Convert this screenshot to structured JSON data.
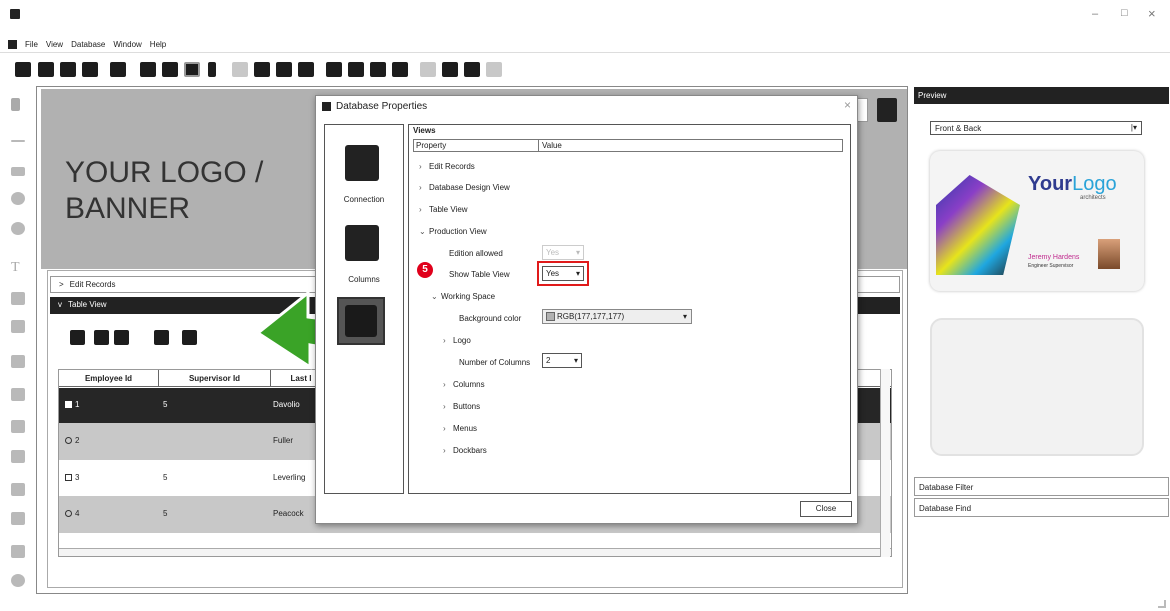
{
  "menu": {
    "items": [
      "File",
      "View",
      "Database",
      "Window",
      "Help"
    ]
  },
  "window_controls": {
    "minimize": "–",
    "maximize": "□",
    "close": "×"
  },
  "canvas": {
    "logo_line1": "YOUR LOGO /",
    "logo_line2": "BANNER"
  },
  "records": {
    "edit_records": "Edit Records",
    "table_view": "Table View",
    "columns": [
      "Employee Id",
      "Supervisor Id",
      "Last I"
    ],
    "rows": [
      {
        "id": "1",
        "sup": "5",
        "last": "Davolio"
      },
      {
        "id": "2",
        "sup": "",
        "last": "Fuller"
      },
      {
        "id": "3",
        "sup": "5",
        "last": "Leverling"
      },
      {
        "id": "4",
        "sup": "5",
        "last": "Peacock"
      }
    ]
  },
  "dialog": {
    "title": "Database Properties",
    "close_x": "×",
    "nav": [
      {
        "label": "Connection"
      },
      {
        "label": "Columns"
      }
    ],
    "group": "Views",
    "header_property": "Property",
    "header_value": "Value",
    "props": {
      "edit_records": "Edit Records",
      "db_design": "Database Design View",
      "table_view": "Table View",
      "production_view": "Production View",
      "edition_allowed": "Edition allowed",
      "edition_allowed_value": "Yes",
      "show_table_view": "Show Table View",
      "show_table_view_value": "Yes",
      "working_space": "Working Space",
      "background_color": "Background color",
      "background_color_value": "RGB(177,177,177)",
      "logo": "Logo",
      "number_of_columns": "Number of Columns",
      "number_of_columns_value": "2",
      "columns": "Columns",
      "buttons": "Buttons",
      "menus": "Menus",
      "dockbars": "Dockbars"
    },
    "close_button": "Close",
    "step_badge": "5"
  },
  "preview": {
    "title": "Preview",
    "select_value": "Front & Back",
    "card": {
      "logo_your": "Your",
      "logo_logo": "Logo",
      "logo_sub": "architects",
      "name": "Jeremy Hardens",
      "role": "Engineer Supervisor"
    }
  },
  "panels": {
    "filter": "Database Filter",
    "find": "Database Find"
  },
  "colors": {
    "dark": "#222222",
    "canvas_gray": "#b1b1b1",
    "badge_red": "#e0001b",
    "arrow_green": "#3aa327",
    "highlight_red": "#e01a1a"
  }
}
